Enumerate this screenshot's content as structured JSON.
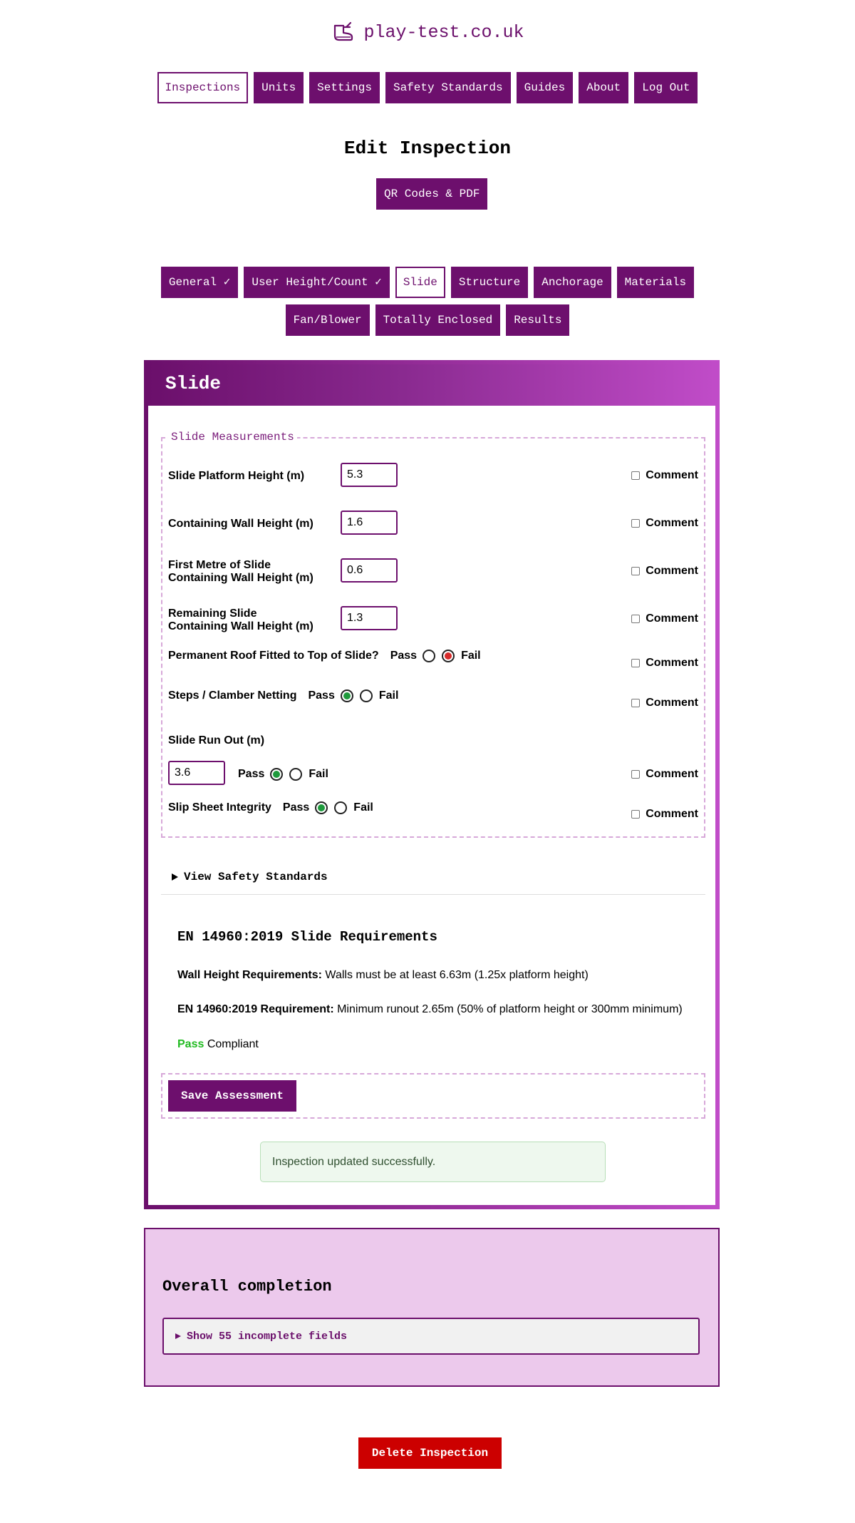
{
  "site": {
    "title": "play-test.co.uk",
    "logo_icon": "shoe-icon"
  },
  "nav": [
    "Inspections",
    "Units",
    "Settings",
    "Safety Standards",
    "Guides",
    "About",
    "Log Out"
  ],
  "nav_active": "Inspections",
  "page": {
    "title": "Edit Inspection",
    "qr_button": "QR Codes & PDF"
  },
  "tabs": {
    "row1": [
      "General ✓",
      "User Height/Count ✓",
      "Slide",
      "Structure",
      "Anchorage",
      "Materials"
    ],
    "row2": [
      "Fan/Blower",
      "Totally Enclosed",
      "Results"
    ],
    "active": "Slide"
  },
  "panel": {
    "title": "Slide",
    "fieldset_legend": "Slide Measurements",
    "comment_label": "Comment",
    "pass_label": "Pass",
    "fail_label": "Fail",
    "fields": {
      "platform_height": {
        "label_1": "Slide Platform Height (m)",
        "value": "5.3"
      },
      "wall_height": {
        "label_1": "Containing Wall Height (m)",
        "value": "1.6"
      },
      "first_metre": {
        "label_1": "First Metre of Slide",
        "label_2": "Containing Wall Height (m)",
        "value": "0.6"
      },
      "remaining": {
        "label_1": "Remaining Slide",
        "label_2": "Containing Wall Height (m)",
        "value": "1.3"
      },
      "roof": {
        "label": "Permanent Roof Fitted to Top of Slide?",
        "selected": "Fail"
      },
      "steps": {
        "label": "Steps / Clamber Netting",
        "selected": "Pass"
      },
      "run_out": {
        "label": "Slide Run Out (m)",
        "value": "3.6",
        "selected": "Pass"
      },
      "slip_sheet": {
        "label": "Slip Sheet Integrity",
        "selected": "Pass"
      }
    },
    "safety_toggle": "View Safety Standards",
    "standards": {
      "title": "EN 14960:2019 Slide Requirements",
      "wall_label": "Wall Height Requirements:",
      "wall_text": " Walls must be at least 6.63m (1.25x platform height)",
      "runout_label": "EN 14960:2019 Requirement:",
      "runout_text": " Minimum runout 2.65m (50% of platform height or 300mm minimum)",
      "status": "Pass",
      "status_text": " Compliant"
    },
    "save_button": "Save Assessment",
    "flash": "Inspection updated successfully."
  },
  "completion": {
    "title": "Overall completion",
    "toggle": "Show 55 incomplete fields"
  },
  "delete_button": "Delete Inspection",
  "colors": {
    "brand": "#6d0f6d",
    "gradient_end": "#c04cc8",
    "pass": "#1e9a3c",
    "fail": "#d62b2b",
    "danger": "#cc0000"
  }
}
